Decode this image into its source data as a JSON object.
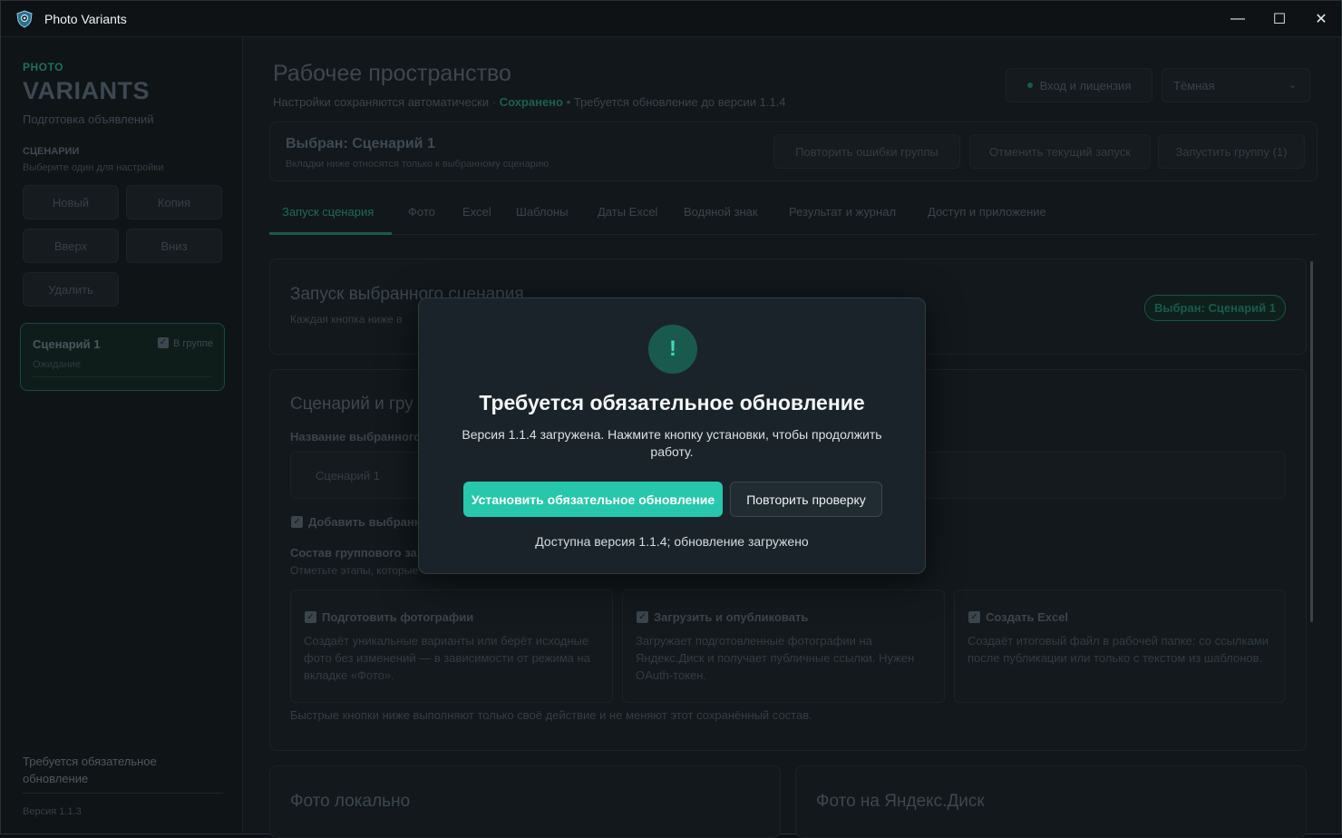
{
  "window": {
    "title": "Photo Variants",
    "minimize": "—",
    "maximize": "☐",
    "close": "✕"
  },
  "sidebar": {
    "brand_small": "PHOTO",
    "brand_big": "VARIANTS",
    "brand_sub": "Подготовка объявлений",
    "scenarios_heading": "СЦЕНАРИИ",
    "scenarios_hint": "Выберите один для настройки",
    "buttons": {
      "new": "Новый",
      "copy": "Копия",
      "up": "Вверх",
      "down": "Вниз",
      "delete": "Удалить"
    },
    "scenario": {
      "name": "Сценарий 1",
      "group": "В группе",
      "status": "Ожидание"
    },
    "footer_text": "Требуется обязательное обновление",
    "version": "Версия 1.1.3"
  },
  "header": {
    "title": "Рабочее пространство",
    "sub_prefix": "Настройки сохраняются автоматически · ",
    "saved": "Сохранено",
    "sub_suffix": " •  Требуется обновление до версии 1.1.4",
    "login_button": "Вход и лицензия",
    "theme": "Тёмная"
  },
  "selected_panel": {
    "title": "Выбран: Сценарий 1",
    "subtitle": "Вкладки ниже относятся только к выбранному сценарию",
    "retry_errors": "Повторить ошибки группы",
    "cancel_run": "Отменить текущий запуск",
    "run_group": "Запустить группу (1)"
  },
  "tabs": [
    "Запуск сценария",
    "Фото",
    "Excel",
    "Шаблоны",
    "Даты Excel",
    "Водяной знак",
    "Результат и журнал",
    "Доступ и приложение"
  ],
  "run_card": {
    "title": "Запуск выбранного сценария",
    "text": "Каждая кнопка ниже в",
    "badge": "Выбран: Сценарий 1"
  },
  "scenario_card": {
    "title": "Сценарий и гру",
    "name_label": "Название выбранного",
    "name_value": "Сценарий 1",
    "add_label": "Добавить выбранн",
    "composition_title": "Состав группового за",
    "composition_hint": "Отметьте этапы, которые",
    "stages": [
      {
        "title": "Подготовить фотографии",
        "desc": "Создаёт уникальные варианты или берёт исходные фото без изменений — в зависимости от режима на вкладке «Фото»."
      },
      {
        "title": "Загрузить и опубликовать",
        "desc": "Загружает подготовленные фотографии на Яндекс.Диск и получает публичные ссылки. Нужен OAuth-токен."
      },
      {
        "title": "Создать Excel",
        "desc": "Создаёт итоговый файл в рабочей папке: со ссылками после публикации или только с текстом из шаблонов."
      }
    ],
    "footnote": "Быстрые кнопки ниже выполняют только своё действие и не меняют этот сохранённый состав."
  },
  "bottom_cards": {
    "local": "Фото локально",
    "yandex": "Фото на Яндекс.Диск"
  },
  "modal": {
    "icon": "!",
    "title": "Требуется обязательное обновление",
    "text": "Версия 1.1.4 загружена. Нажмите кнопку установки, чтобы продолжить работу.",
    "install_button": "Установить обязательное обновление",
    "retry_button": "Повторить проверку",
    "status": "Доступна версия 1.1.4; обновление загружено"
  }
}
